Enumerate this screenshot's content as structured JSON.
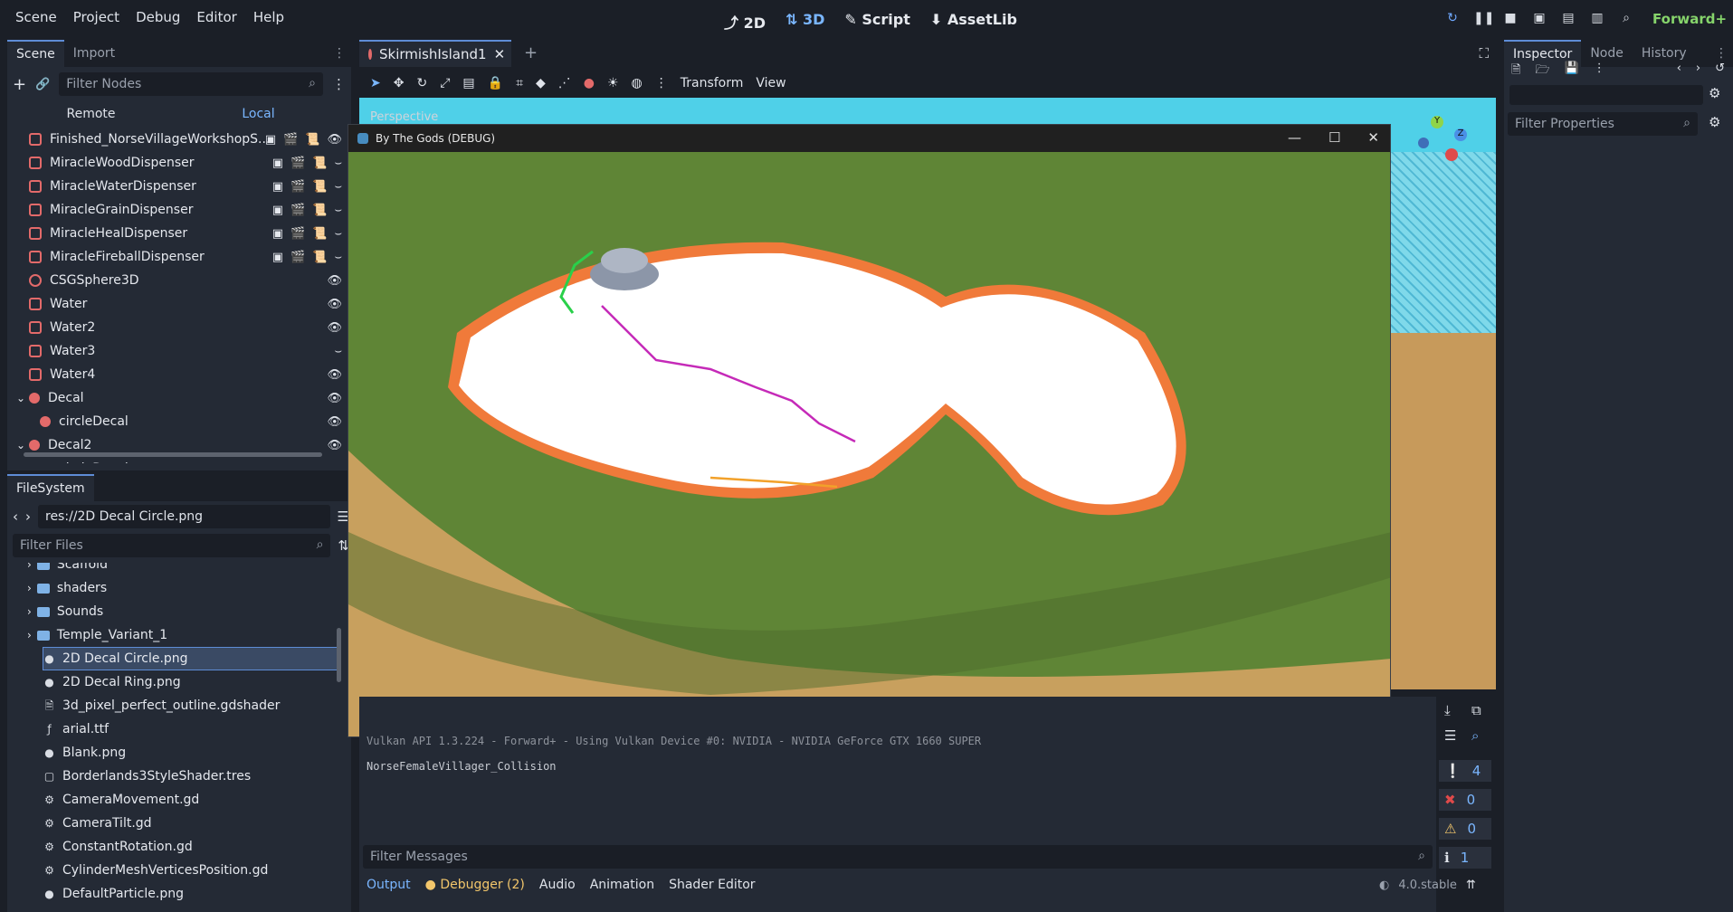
{
  "menu": [
    "Scene",
    "Project",
    "Debug",
    "Editor",
    "Help"
  ],
  "modes": {
    "m2d": "2D",
    "m3d": "3D",
    "script": "Script",
    "assetlib": "AssetLib"
  },
  "renderer": "Forward+",
  "scene_dock": {
    "tabs": [
      "Scene",
      "Import"
    ],
    "filter_placeholder": "Filter Nodes",
    "remote": "Remote",
    "local": "Local",
    "nodes": [
      {
        "name": "Finished_NorseVillageWorkshopS...",
        "icon": "box"
      },
      {
        "name": "MiracleWoodDispenser",
        "icon": "box"
      },
      {
        "name": "MiracleWaterDispenser",
        "icon": "box"
      },
      {
        "name": "MiracleGrainDispenser",
        "icon": "box"
      },
      {
        "name": "MiracleHealDispenser",
        "icon": "box"
      },
      {
        "name": "MiracleFireballDispenser",
        "icon": "box"
      },
      {
        "name": "CSGSphere3D",
        "icon": "sphere"
      },
      {
        "name": "Water",
        "icon": "box"
      },
      {
        "name": "Water2",
        "icon": "box"
      },
      {
        "name": "Water3",
        "icon": "box"
      },
      {
        "name": "Water4",
        "icon": "box"
      },
      {
        "name": "Decal",
        "icon": "dot"
      },
      {
        "name": "circleDecal",
        "icon": "dot"
      },
      {
        "name": "Decal2",
        "icon": "dot"
      },
      {
        "name": "circleDecal",
        "icon": "dot"
      }
    ]
  },
  "filesystem": {
    "tab": "FileSystem",
    "path": "res://2D Decal Circle.png",
    "filter_placeholder": "Filter Files",
    "items": [
      {
        "name": "Scaffold",
        "type": "folder"
      },
      {
        "name": "shaders",
        "type": "folder"
      },
      {
        "name": "Sounds",
        "type": "folder"
      },
      {
        "name": "Temple_Variant_1",
        "type": "folder"
      },
      {
        "name": "2D Decal Circle.png",
        "type": "image",
        "selected": true
      },
      {
        "name": "2D Decal Ring.png",
        "type": "image"
      },
      {
        "name": "3d_pixel_perfect_outline.gdshader",
        "type": "shader"
      },
      {
        "name": "arial.ttf",
        "type": "font"
      },
      {
        "name": "Blank.png",
        "type": "image"
      },
      {
        "name": "Borderlands3StyleShader.tres",
        "type": "resource"
      },
      {
        "name": "CameraMovement.gd",
        "type": "script"
      },
      {
        "name": "CameraTilt.gd",
        "type": "script"
      },
      {
        "name": "ConstantRotation.gd",
        "type": "script"
      },
      {
        "name": "CylinderMeshVerticesPosition.gd",
        "type": "script"
      },
      {
        "name": "DefaultParticle.png",
        "type": "image"
      }
    ]
  },
  "editor_tab": "SkirmishIsland1",
  "viewport": {
    "toolbar_menus": [
      "Transform",
      "View"
    ],
    "label": "Perspective"
  },
  "game_window": {
    "title": "By The Gods (DEBUG)"
  },
  "console": {
    "line1": "Vulkan API 1.3.224 - Forward+ - Using Vulkan Device #0: NVIDIA - NVIDIA GeForce GTX 1660 SUPER",
    "line2": "NorseFemaleVillager_Collision",
    "filter_placeholder": "Filter Messages",
    "counts": {
      "messages": "4",
      "errors": "0",
      "warnings": "0",
      "info": "1"
    }
  },
  "bottom_tabs": [
    "Output",
    "Debugger (2)",
    "Audio",
    "Animation",
    "Shader Editor"
  ],
  "version": "4.0.stable",
  "inspector": {
    "tabs": [
      "Inspector",
      "Node",
      "History"
    ],
    "filter_placeholder": "Filter Properties"
  },
  "colors": {
    "accent": "#5e8cd6",
    "node_icon": "#e36a6a",
    "folder": "#7fb2e6",
    "forward": "#86d46b"
  }
}
